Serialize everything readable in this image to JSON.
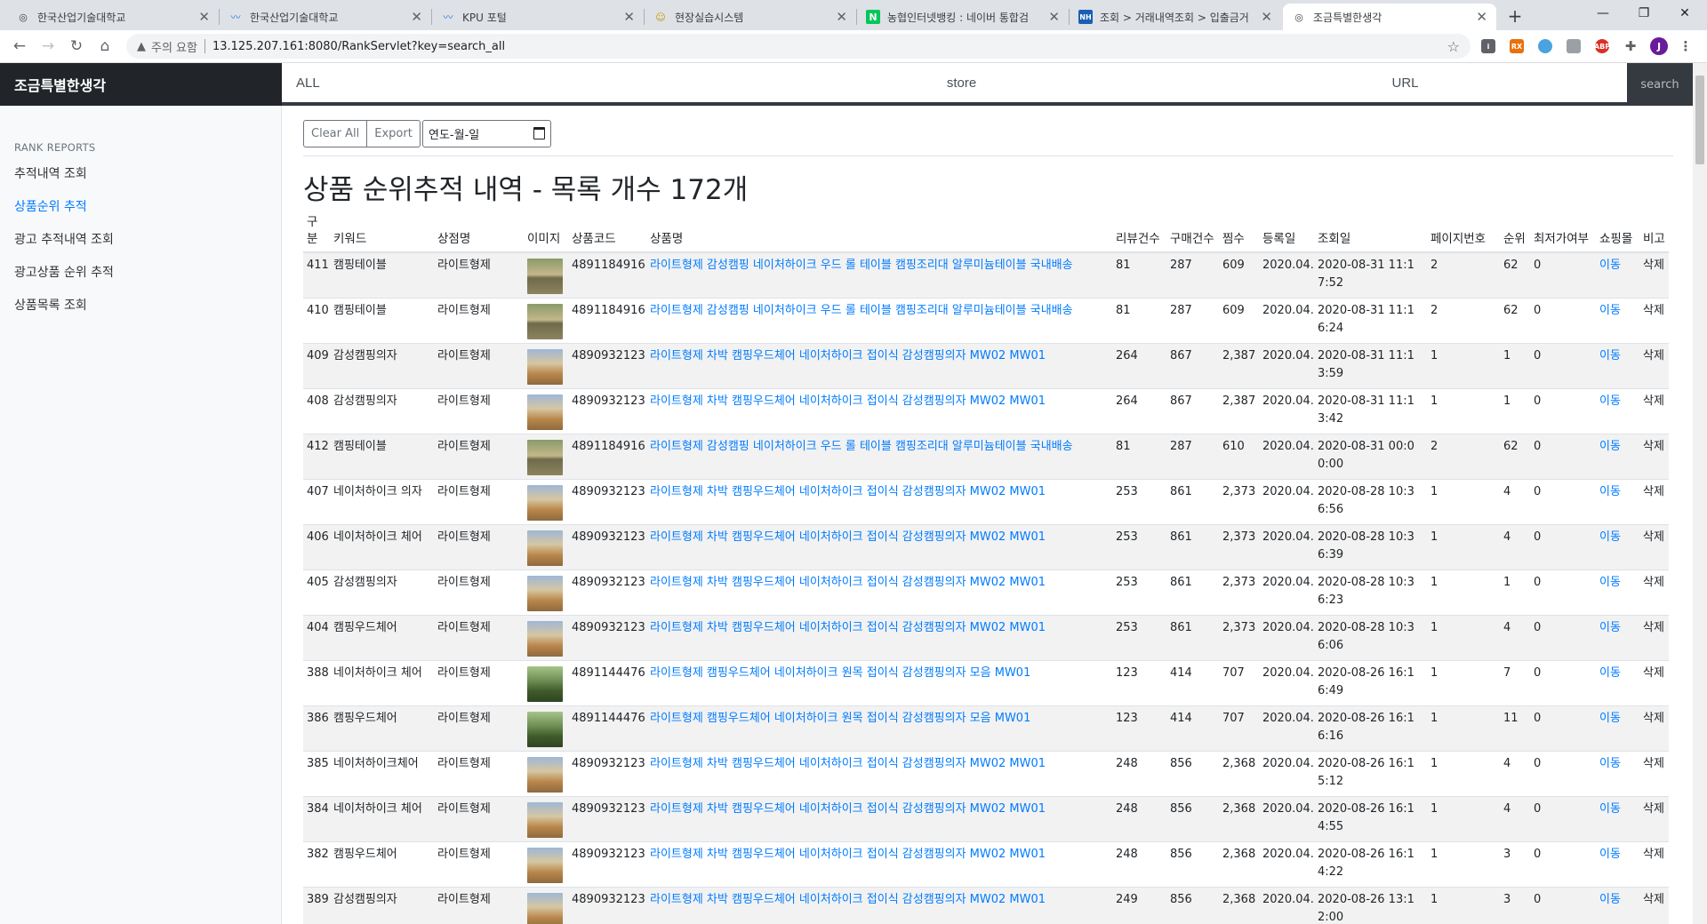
{
  "browser": {
    "tabs": [
      {
        "title": "한국산업기술대학교",
        "favicon": "globe-icon"
      },
      {
        "title": "한국산업기술대학교",
        "favicon": "kpu-logo-icon"
      },
      {
        "title": "KPU 포털",
        "favicon": "kpu-logo-icon"
      },
      {
        "title": "현장실습시스템",
        "favicon": "badge-icon"
      },
      {
        "title": "농협인터넷뱅킹 : 네이버 통합검",
        "favicon": "naver-n-icon"
      },
      {
        "title": "조회 > 거래내역조회 > 입출금거",
        "favicon": "nh-icon"
      },
      {
        "title": "조금특별한생각",
        "favicon": "globe-icon"
      }
    ],
    "security_label": "주의 요함",
    "url": "13.125.207.161:8080/RankServlet?key=search_all",
    "profile_initial": "J",
    "extensions": [
      "ABP",
      "RX"
    ]
  },
  "app": {
    "brand": "조금특별한생각",
    "search": {
      "all_placeholder": "ALL",
      "store_placeholder": "store",
      "url_placeholder": "URL",
      "button": "search"
    }
  },
  "sidebar": {
    "heading": "RANK REPORTS",
    "items": [
      {
        "label": "추적내역 조회",
        "active": false
      },
      {
        "label": "상품순위 추적",
        "active": true
      },
      {
        "label": "광고 추적내역 조회",
        "active": false
      },
      {
        "label": "광고상품 순위 추적",
        "active": false
      },
      {
        "label": "상품목록 조회",
        "active": false
      }
    ]
  },
  "main": {
    "clear_all": "Clear All",
    "export": "Export",
    "date_placeholder": "연도-월-일",
    "title": "상품 순위추적 내역 - 목록 개수 172개"
  },
  "table": {
    "headers": [
      "구분",
      "키워드",
      "상점명",
      "이미지",
      "상품코드",
      "상품명",
      "리뷰건수",
      "구매건수",
      "찜수",
      "등록일",
      "조회일",
      "페이지번호",
      "순위",
      "최저가여부",
      "쇼핑몰",
      "비고"
    ],
    "rows": [
      {
        "no": "411",
        "keyword": "캠핑테이블",
        "store": "라이트형제",
        "img": "table",
        "code": "4891184916",
        "name": "라이트형제 감성캠핑 네이처하이크 우드 롤 테이블 캠핑조리대 알루미늄테이블 국내배송",
        "review": "81",
        "purchase": "287",
        "zzim": "609",
        "reg": "2020.04.",
        "date": "2020-08-31 11:17:52",
        "page": "2",
        "rank": "62",
        "lowest": "0",
        "mall": "이동",
        "note": "삭제"
      },
      {
        "no": "410",
        "keyword": "캠핑테이블",
        "store": "라이트형제",
        "img": "table",
        "code": "4891184916",
        "name": "라이트형제 감성캠핑 네이처하이크 우드 롤 테이블 캠핑조리대 알루미늄테이블 국내배송",
        "review": "81",
        "purchase": "287",
        "zzim": "609",
        "reg": "2020.04.",
        "date": "2020-08-31 11:16:24",
        "page": "2",
        "rank": "62",
        "lowest": "0",
        "mall": "이동",
        "note": "삭제"
      },
      {
        "no": "409",
        "keyword": "감성캠핑의자",
        "store": "라이트형제",
        "img": "chair",
        "code": "4890932123",
        "name": "라이트형제 차박 캠핑우드체어 네이처하이크 접이식 감성캠핑의자 MW02 MW01",
        "review": "264",
        "purchase": "867",
        "zzim": "2,387",
        "reg": "2020.04.",
        "date": "2020-08-31 11:13:59",
        "page": "1",
        "rank": "1",
        "lowest": "0",
        "mall": "이동",
        "note": "삭제"
      },
      {
        "no": "408",
        "keyword": "감성캠핑의자",
        "store": "라이트형제",
        "img": "chair",
        "code": "4890932123",
        "name": "라이트형제 차박 캠핑우드체어 네이처하이크 접이식 감성캠핑의자 MW02 MW01",
        "review": "264",
        "purchase": "867",
        "zzim": "2,387",
        "reg": "2020.04.",
        "date": "2020-08-31 11:13:42",
        "page": "1",
        "rank": "1",
        "lowest": "0",
        "mall": "이동",
        "note": "삭제"
      },
      {
        "no": "412",
        "keyword": "캠핑테이블",
        "store": "라이트형제",
        "img": "table",
        "code": "4891184916",
        "name": "라이트형제 감성캠핑 네이처하이크 우드 롤 테이블 캠핑조리대 알루미늄테이블 국내배송",
        "review": "81",
        "purchase": "287",
        "zzim": "610",
        "reg": "2020.04.",
        "date": "2020-08-31 00:00:00",
        "page": "2",
        "rank": "62",
        "lowest": "0",
        "mall": "이동",
        "note": "삭제"
      },
      {
        "no": "407",
        "keyword": "네이처하이크 의자",
        "store": "라이트형제",
        "img": "chair",
        "code": "4890932123",
        "name": "라이트형제 차박 캠핑우드체어 네이처하이크 접이식 감성캠핑의자 MW02 MW01",
        "review": "253",
        "purchase": "861",
        "zzim": "2,373",
        "reg": "2020.04.",
        "date": "2020-08-28 10:36:56",
        "page": "1",
        "rank": "4",
        "lowest": "0",
        "mall": "이동",
        "note": "삭제"
      },
      {
        "no": "406",
        "keyword": "네이처하이크 체어",
        "store": "라이트형제",
        "img": "chair",
        "code": "4890932123",
        "name": "라이트형제 차박 캠핑우드체어 네이처하이크 접이식 감성캠핑의자 MW02 MW01",
        "review": "253",
        "purchase": "861",
        "zzim": "2,373",
        "reg": "2020.04.",
        "date": "2020-08-28 10:36:39",
        "page": "1",
        "rank": "4",
        "lowest": "0",
        "mall": "이동",
        "note": "삭제"
      },
      {
        "no": "405",
        "keyword": "감성캠핑의자",
        "store": "라이트형제",
        "img": "chair",
        "code": "4890932123",
        "name": "라이트형제 차박 캠핑우드체어 네이처하이크 접이식 감성캠핑의자 MW02 MW01",
        "review": "253",
        "purchase": "861",
        "zzim": "2,373",
        "reg": "2020.04.",
        "date": "2020-08-28 10:36:23",
        "page": "1",
        "rank": "1",
        "lowest": "0",
        "mall": "이동",
        "note": "삭제"
      },
      {
        "no": "404",
        "keyword": "캠핑우드체어",
        "store": "라이트형제",
        "img": "chair",
        "code": "4890932123",
        "name": "라이트형제 차박 캠핑우드체어 네이처하이크 접이식 감성캠핑의자 MW02 MW01",
        "review": "253",
        "purchase": "861",
        "zzim": "2,373",
        "reg": "2020.04.",
        "date": "2020-08-28 10:36:06",
        "page": "1",
        "rank": "4",
        "lowest": "0",
        "mall": "이동",
        "note": "삭제"
      },
      {
        "no": "388",
        "keyword": "네이처하이크 체어",
        "store": "라이트형제",
        "img": "green",
        "code": "4891144476",
        "name": "라이트형제 캠핑우드체어 네이처하이크 원목 접이식 감성캠핑의자 모음 MW01",
        "review": "123",
        "purchase": "414",
        "zzim": "707",
        "reg": "2020.04.",
        "date": "2020-08-26 16:16:49",
        "page": "1",
        "rank": "7",
        "lowest": "0",
        "mall": "이동",
        "note": "삭제"
      },
      {
        "no": "386",
        "keyword": "캠핑우드체어",
        "store": "라이트형제",
        "img": "green",
        "code": "4891144476",
        "name": "라이트형제 캠핑우드체어 네이처하이크 원목 접이식 감성캠핑의자 모음 MW01",
        "review": "123",
        "purchase": "414",
        "zzim": "707",
        "reg": "2020.04.",
        "date": "2020-08-26 16:16:16",
        "page": "1",
        "rank": "11",
        "lowest": "0",
        "mall": "이동",
        "note": "삭제"
      },
      {
        "no": "385",
        "keyword": "네이처하이크체어",
        "store": "라이트형제",
        "img": "chair",
        "code": "4890932123",
        "name": "라이트형제 차박 캠핑우드체어 네이처하이크 접이식 감성캠핑의자 MW02 MW01",
        "review": "248",
        "purchase": "856",
        "zzim": "2,368",
        "reg": "2020.04.",
        "date": "2020-08-26 16:15:12",
        "page": "1",
        "rank": "4",
        "lowest": "0",
        "mall": "이동",
        "note": "삭제"
      },
      {
        "no": "384",
        "keyword": "네이처하이크 체어",
        "store": "라이트형제",
        "img": "chair",
        "code": "4890932123",
        "name": "라이트형제 차박 캠핑우드체어 네이처하이크 접이식 감성캠핑의자 MW02 MW01",
        "review": "248",
        "purchase": "856",
        "zzim": "2,368",
        "reg": "2020.04.",
        "date": "2020-08-26 16:14:55",
        "page": "1",
        "rank": "4",
        "lowest": "0",
        "mall": "이동",
        "note": "삭제"
      },
      {
        "no": "382",
        "keyword": "캠핑우드체어",
        "store": "라이트형제",
        "img": "chair",
        "code": "4890932123",
        "name": "라이트형제 차박 캠핑우드체어 네이처하이크 접이식 감성캠핑의자 MW02 MW01",
        "review": "248",
        "purchase": "856",
        "zzim": "2,368",
        "reg": "2020.04.",
        "date": "2020-08-26 16:14:22",
        "page": "1",
        "rank": "3",
        "lowest": "0",
        "mall": "이동",
        "note": "삭제"
      },
      {
        "no": "389",
        "keyword": "감성캠핑의자",
        "store": "라이트형제",
        "img": "chair",
        "code": "4890932123",
        "name": "라이트형제 차박 캠핑우드체어 네이처하이크 접이식 감성캠핑의자 MW02 MW01",
        "review": "249",
        "purchase": "856",
        "zzim": "2,368",
        "reg": "2020.04.",
        "date": "2020-08-26 13:12:00",
        "page": "1",
        "rank": "3",
        "lowest": "0",
        "mall": "이동",
        "note": "삭제"
      }
    ]
  }
}
